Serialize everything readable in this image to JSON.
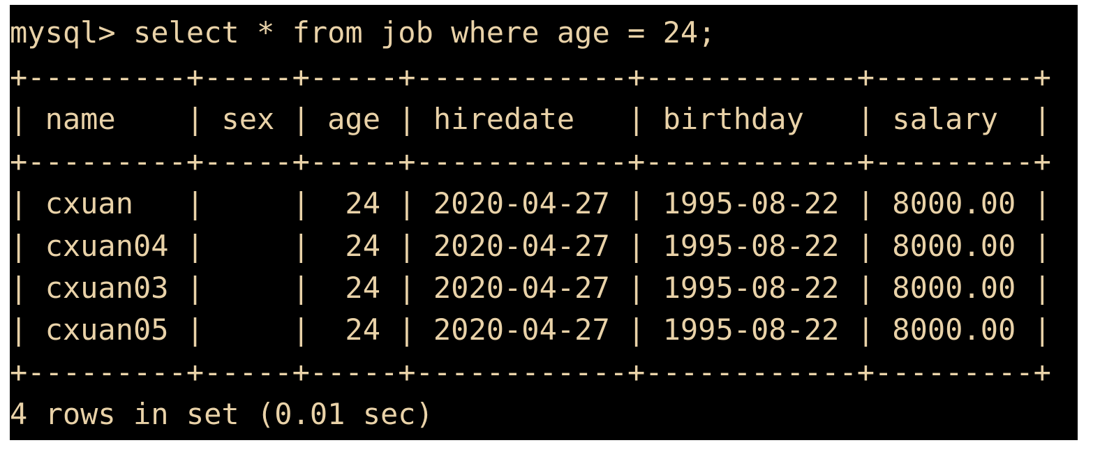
{
  "terminal": {
    "prompt": "mysql> select * from job where age = 24;",
    "border_top": "+---------+-----+-----+------------+------------+---------+",
    "header": "| name    | sex | age | hiredate   | birthday   | salary  |",
    "border_mid": "+---------+-----+-----+------------+------------+---------+",
    "rows": [
      "| cxuan   |     |  24 | 2020-04-27 | 1995-08-22 | 8000.00 |",
      "| cxuan04 |     |  24 | 2020-04-27 | 1995-08-22 | 8000.00 |",
      "| cxuan03 |     |  24 | 2020-04-27 | 1995-08-22 | 8000.00 |",
      "| cxuan05 |     |  24 | 2020-04-27 | 1995-08-22 | 8000.00 |"
    ],
    "border_bottom": "+---------+-----+-----+------------+------------+---------+",
    "result": "4 rows in set (0.01 sec)"
  },
  "colors": {
    "background": "#000000",
    "text": "#e9d2a8"
  }
}
